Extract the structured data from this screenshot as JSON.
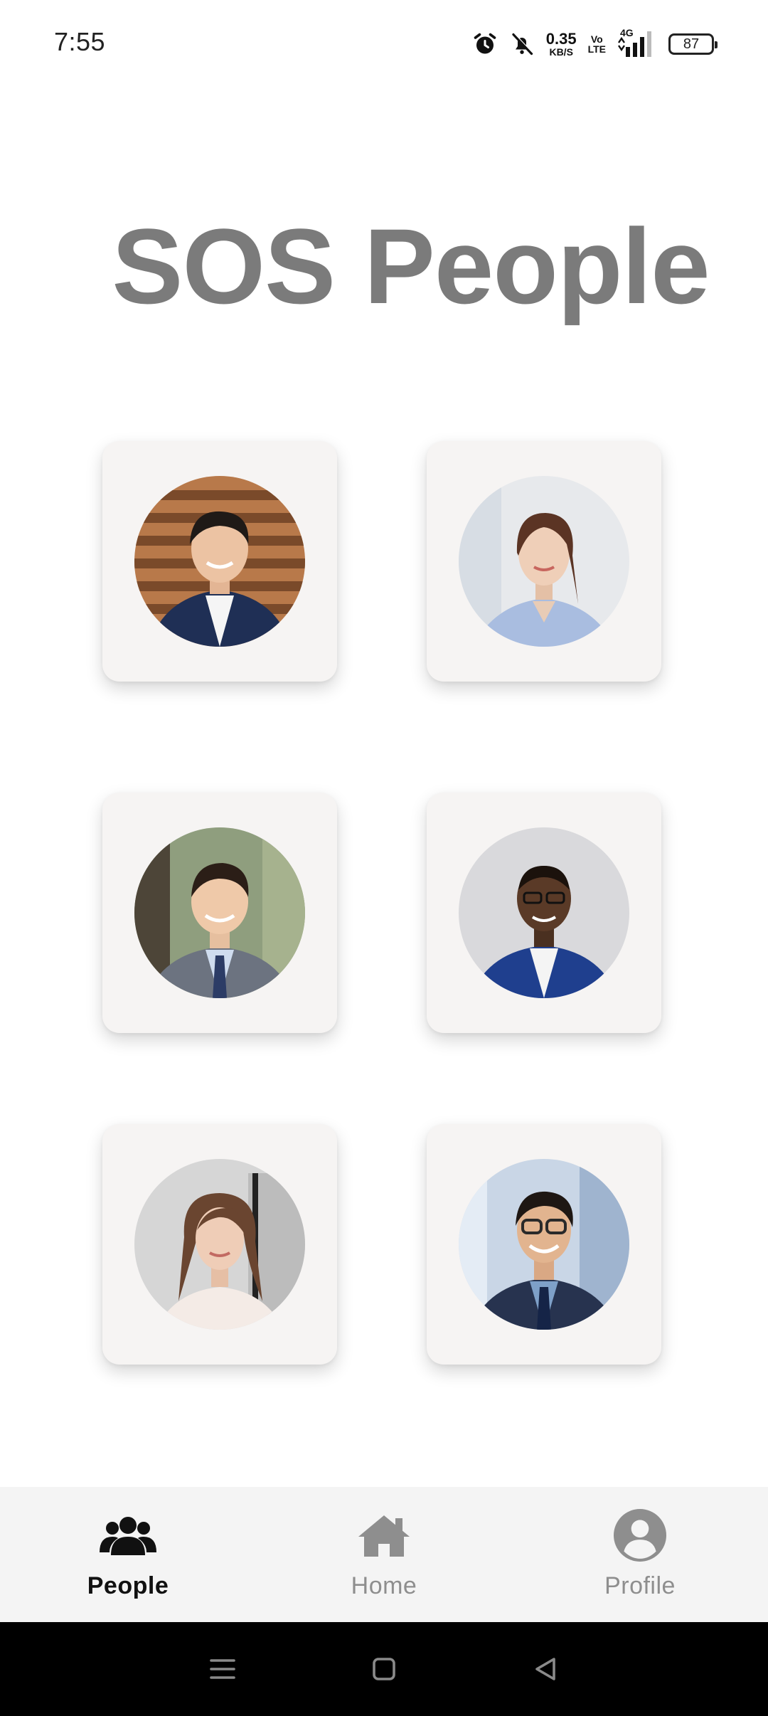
{
  "status_bar": {
    "time": "7:55",
    "net_speed_value": "0.35",
    "net_speed_unit": "KB/S",
    "volte_top": "Vo",
    "volte_bottom": "LTE",
    "network_type": "4G",
    "battery_level": "87",
    "icons": [
      "alarm-icon",
      "mute-icon",
      "signal-icon",
      "battery-icon"
    ]
  },
  "page": {
    "title": "SOS People"
  },
  "people_cards": [
    {
      "icon": "person-photo"
    },
    {
      "icon": "person-photo"
    },
    {
      "icon": "person-photo"
    },
    {
      "icon": "person-photo"
    },
    {
      "icon": "person-photo"
    },
    {
      "icon": "person-photo"
    }
  ],
  "bottom_nav": {
    "items": [
      {
        "label": "People",
        "icon": "people-icon",
        "active": true
      },
      {
        "label": "Home",
        "icon": "home-icon",
        "active": false
      },
      {
        "label": "Profile",
        "icon": "profile-icon",
        "active": false
      }
    ]
  },
  "system_nav": {
    "icons": [
      "menu-icon",
      "home-square-icon",
      "back-icon"
    ]
  },
  "colors": {
    "title": "#7b7b7b",
    "card_bg": "#f6f4f3",
    "nav_bg": "#f4f4f4",
    "nav_active": "#111111",
    "nav_inactive": "#8e8e8e"
  }
}
